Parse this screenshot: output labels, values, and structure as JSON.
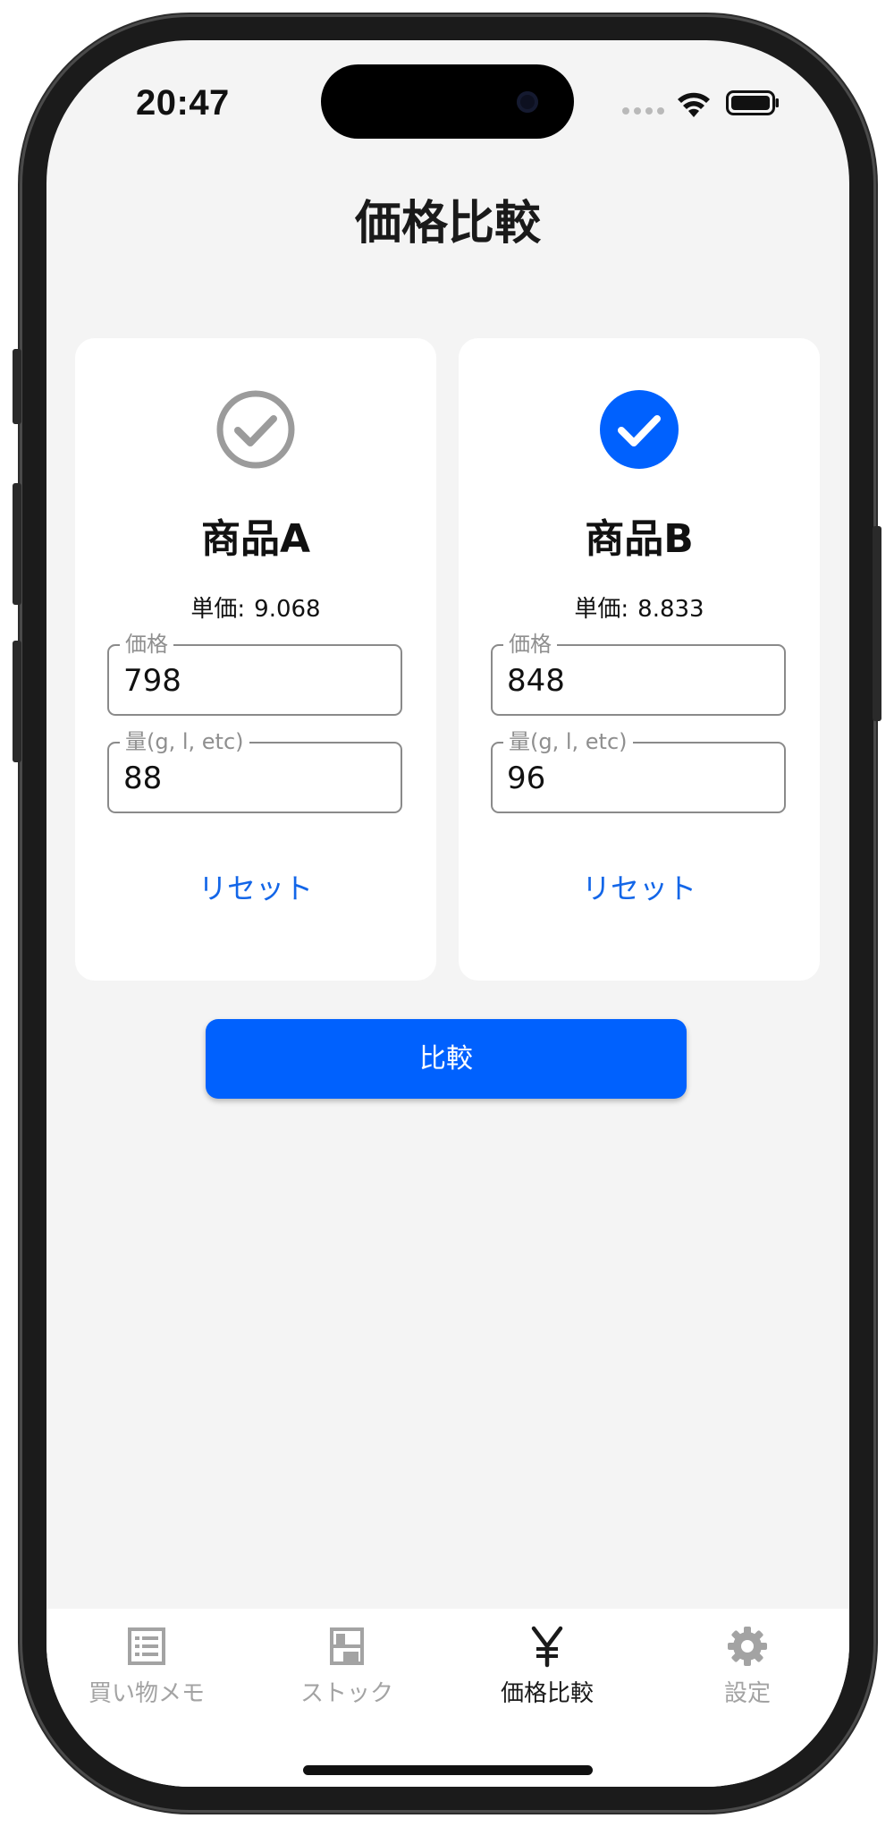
{
  "status_bar": {
    "time": "20:47"
  },
  "header": {
    "title": "価格比較"
  },
  "products": [
    {
      "name": "商品A",
      "selected": false,
      "unit_price_label": "単価:",
      "unit_price_value": "9.068",
      "price_legend": "価格",
      "price_value": "798",
      "amount_legend": "量(g, l, etc)",
      "amount_value": "88",
      "reset_label": "リセット"
    },
    {
      "name": "商品B",
      "selected": true,
      "unit_price_label": "単価:",
      "unit_price_value": "8.833",
      "price_legend": "価格",
      "price_value": "848",
      "amount_legend": "量(g, l, etc)",
      "amount_value": "96",
      "reset_label": "リセット"
    }
  ],
  "compare_button": {
    "label": "比較"
  },
  "tab_bar": {
    "tabs": [
      {
        "label": "買い物メモ",
        "icon": "list-icon",
        "active": false
      },
      {
        "label": "ストック",
        "icon": "shelf-icon",
        "active": false
      },
      {
        "label": "価格比較",
        "icon": "yen-icon",
        "active": true
      },
      {
        "label": "設定",
        "icon": "gear-icon",
        "active": false
      }
    ]
  },
  "colors": {
    "accent": "#0061fe",
    "link": "#1366e8",
    "inactive": "#a3a3a3",
    "background": "#f4f4f4"
  }
}
